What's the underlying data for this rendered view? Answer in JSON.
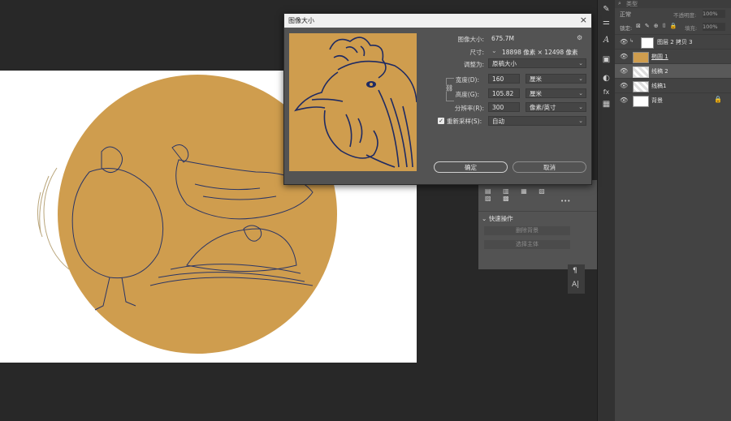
{
  "dialog": {
    "title": "图像大小",
    "close_glyph": "×",
    "image_size_label": "图像大小:",
    "image_size_value": "675.7M",
    "dimensions_label": "尺寸:",
    "dimensions_value": "18898 像素  ×  12498 像素",
    "fit_to_label": "调整为:",
    "fit_to_value": "原稿大小",
    "width_label": "宽度(D):",
    "width_value": "160",
    "width_unit": "厘米",
    "height_label": "高度(G):",
    "height_value": "105.82",
    "height_unit": "厘米",
    "resolution_label": "分辨率(R):",
    "resolution_value": "300",
    "resolution_unit": "像素/英寸",
    "resample_label": "重新采样(S):",
    "resample_value": "自动",
    "ok_label": "确定",
    "cancel_label": "取消"
  },
  "layers": {
    "kind_label": "类型",
    "blend_mode": "正常",
    "opacity_label": "不透明度:",
    "opacity_value": "100%",
    "lock_label": "锁定:",
    "fill_label": "填充:",
    "fill_value": "100%",
    "items": [
      {
        "name": "图层 2 拷贝 3"
      },
      {
        "name": "椭圆 1"
      },
      {
        "name": "线稿 2"
      },
      {
        "name": "线稿1"
      },
      {
        "name": "背景"
      }
    ]
  },
  "properties": {
    "quick_actions_title": "快速操作",
    "remove_bg_label": "删除背景",
    "select_subject_label": "选择主体",
    "more_glyph": "•••"
  },
  "colors": {
    "ochre": "#cf9d4e",
    "ink": "#1e2a63"
  }
}
